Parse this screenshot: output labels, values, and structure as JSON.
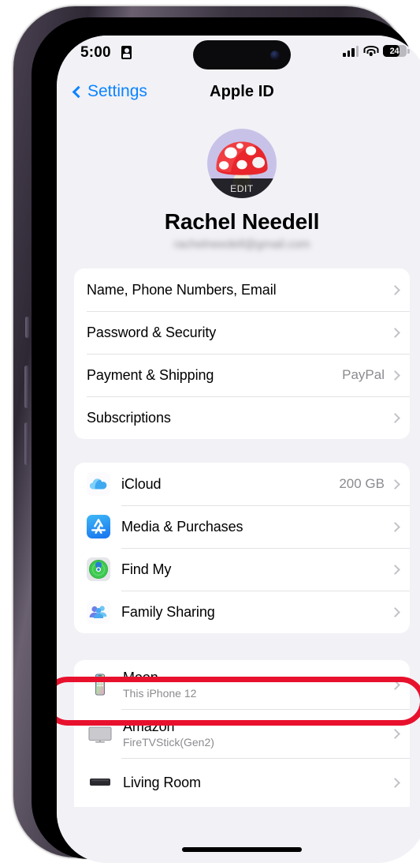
{
  "status_bar": {
    "time": "5:00",
    "recording_icon": "location-indicator-icon",
    "signal_icon": "cellular-signal-icon",
    "wifi_icon": "wifi-icon",
    "battery_percent": "24"
  },
  "nav": {
    "back_label": "Settings",
    "title": "Apple ID",
    "back_icon": "chevron-left-icon"
  },
  "profile": {
    "avatar_emoji": "mushroom-avatar",
    "avatar_bg_color": "#c9c2e8",
    "edit_label": "EDIT",
    "name": "Rachel Needell",
    "email_redacted": "rachelneedell@gmail.com"
  },
  "groups": [
    {
      "name": "account-group",
      "rows": [
        {
          "label": "Name, Phone Numbers, Email",
          "value": "",
          "icon": ""
        },
        {
          "label": "Password & Security",
          "value": "",
          "icon": ""
        },
        {
          "label": "Payment & Shipping",
          "value": "PayPal",
          "icon": ""
        },
        {
          "label": "Subscriptions",
          "value": "",
          "icon": ""
        }
      ]
    },
    {
      "name": "services-group",
      "rows": [
        {
          "label": "iCloud",
          "value": "200 GB",
          "icon": "icloud-icon"
        },
        {
          "label": "Media & Purchases",
          "value": "",
          "icon": "app-store-icon"
        },
        {
          "label": "Find My",
          "value": "",
          "icon": "find-my-icon"
        },
        {
          "label": "Family Sharing",
          "value": "",
          "icon": "family-sharing-icon"
        }
      ]
    }
  ],
  "devices": [
    {
      "name": "Moon",
      "detail": "This iPhone 12",
      "icon": "iphone-icon"
    },
    {
      "name": "Amazon",
      "detail": "FireTVStick(Gen2)",
      "icon": "tv-icon"
    },
    {
      "name": "Living Room",
      "detail": "",
      "icon": "apple-tv-icon"
    }
  ],
  "annotation": {
    "shape": "red-oval-highlight",
    "target": "Find My",
    "color": "#e8112d"
  }
}
